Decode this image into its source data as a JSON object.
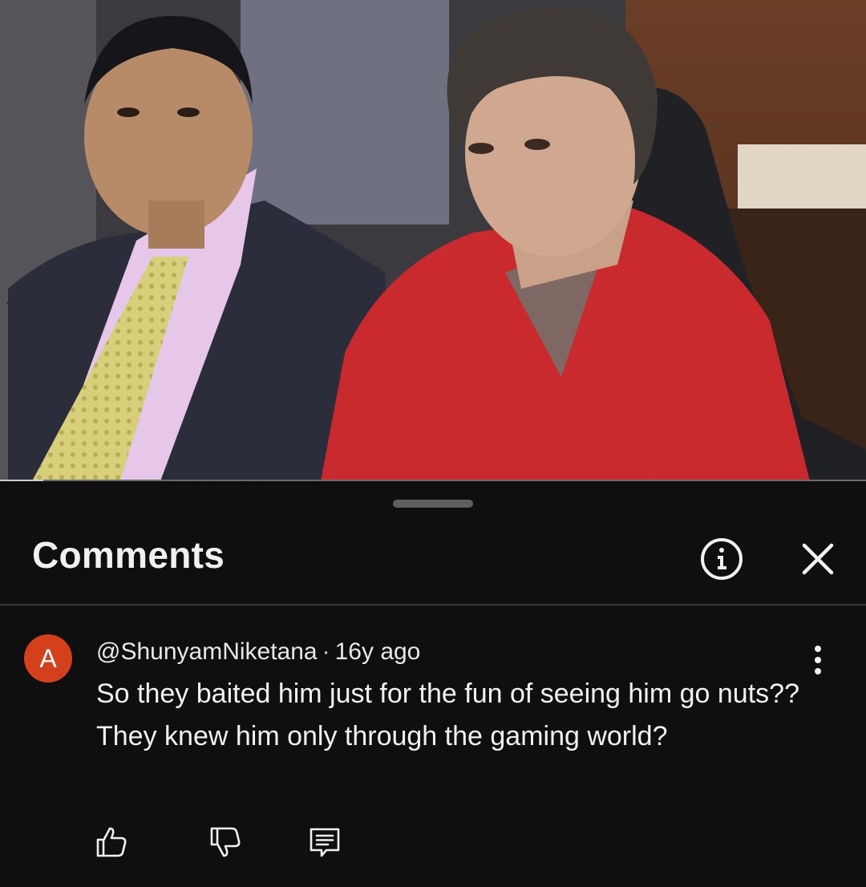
{
  "video": {
    "progress_fraction": 0.05
  },
  "comments_panel": {
    "title": "Comments",
    "info_icon": "info-icon",
    "close_icon": "close-icon"
  },
  "comment": {
    "avatar_letter": "A",
    "avatar_color": "#d4401b",
    "author": "@ShunyamNiketana",
    "separator": "·",
    "time": "16y ago",
    "text": "So they baited him just for the fun of seeing him go nuts?? They knew him only through the gaming world?",
    "more_icon": "more-vertical-icon",
    "actions": {
      "like_icon": "thumbs-up-icon",
      "dislike_icon": "thumbs-down-icon",
      "reply_icon": "reply-icon"
    }
  }
}
